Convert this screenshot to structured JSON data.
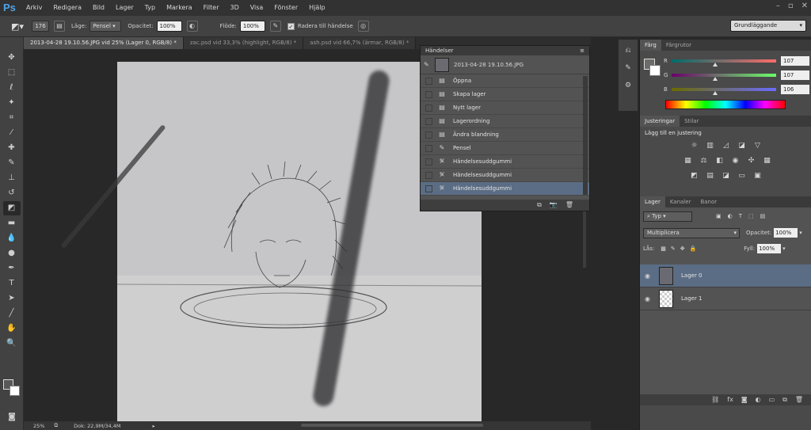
{
  "menubar": {
    "logo": "Ps",
    "items": [
      "Arkiv",
      "Redigera",
      "Bild",
      "Lager",
      "Typ",
      "Markera",
      "Filter",
      "3D",
      "Visa",
      "Fönster",
      "Hjälp"
    ],
    "window_controls": [
      "–",
      "▫",
      "✕"
    ]
  },
  "options": {
    "brush_size": "176",
    "mode_label": "Läge:",
    "mode_value": "Pensel",
    "opacity_label": "Opacitet:",
    "opacity_value": "100%",
    "flow_label": "Flöde:",
    "flow_value": "100%",
    "erase_history_label": "Radera till händelse",
    "workspace": "Grundläggande"
  },
  "tabs": [
    {
      "label": "2013-04-28 19.10.56.JPG vid 25% (Lager 0, RGB/8) *"
    },
    {
      "label": "zac.psd vid 33,3% (highlight, RGB/8) *"
    },
    {
      "label": "ash.psd vid 66,7% (ärmar, RGB/8) *"
    }
  ],
  "status": {
    "zoom": "25%",
    "doc": "Dok: 22,9M/34,4M"
  },
  "history": {
    "title": "Händelser",
    "snapshot": "2013-04-28 19.10.56.JPG",
    "items": [
      {
        "label": "Öppna",
        "icon": "doc-icon"
      },
      {
        "label": "Skapa lager",
        "icon": "doc-icon"
      },
      {
        "label": "Nytt lager",
        "icon": "doc-icon"
      },
      {
        "label": "Lagerordning",
        "icon": "doc-icon"
      },
      {
        "label": "Ändra blandning",
        "icon": "doc-icon"
      },
      {
        "label": "Pensel",
        "icon": "brush-icon"
      },
      {
        "label": "Händelsesuddgummi",
        "icon": "history-eraser-icon"
      },
      {
        "label": "Händelsesuddgummi",
        "icon": "history-eraser-icon"
      },
      {
        "label": "Händelsesuddgummi",
        "icon": "history-eraser-icon"
      }
    ],
    "selected_index": 8
  },
  "color_panel": {
    "tabs": [
      "Färg",
      "Färgrutor"
    ],
    "channels": [
      {
        "label": "R",
        "value": "107",
        "fraction": 0.42
      },
      {
        "label": "G",
        "value": "107",
        "fraction": 0.42
      },
      {
        "label": "B",
        "value": "106",
        "fraction": 0.42
      }
    ]
  },
  "adjustments": {
    "tabs": [
      "Justeringar",
      "Stilar"
    ],
    "heading": "Lägg till en justering"
  },
  "layers": {
    "tabs": [
      "Lager",
      "Kanaler",
      "Banor"
    ],
    "filter_kind": "Typ",
    "blend_mode": "Multiplicera",
    "opacity_label": "Opacitet:",
    "opacity_value": "100%",
    "lock_label": "Lås:",
    "fill_label": "Fyll:",
    "fill_value": "100%",
    "items": [
      {
        "name": "Lager 0",
        "selected": true
      },
      {
        "name": "Lager 1",
        "selected": false
      }
    ]
  },
  "colors": {
    "accent_selected": "#5b6d85",
    "foreground": "#585858",
    "background": "#ffffff"
  }
}
